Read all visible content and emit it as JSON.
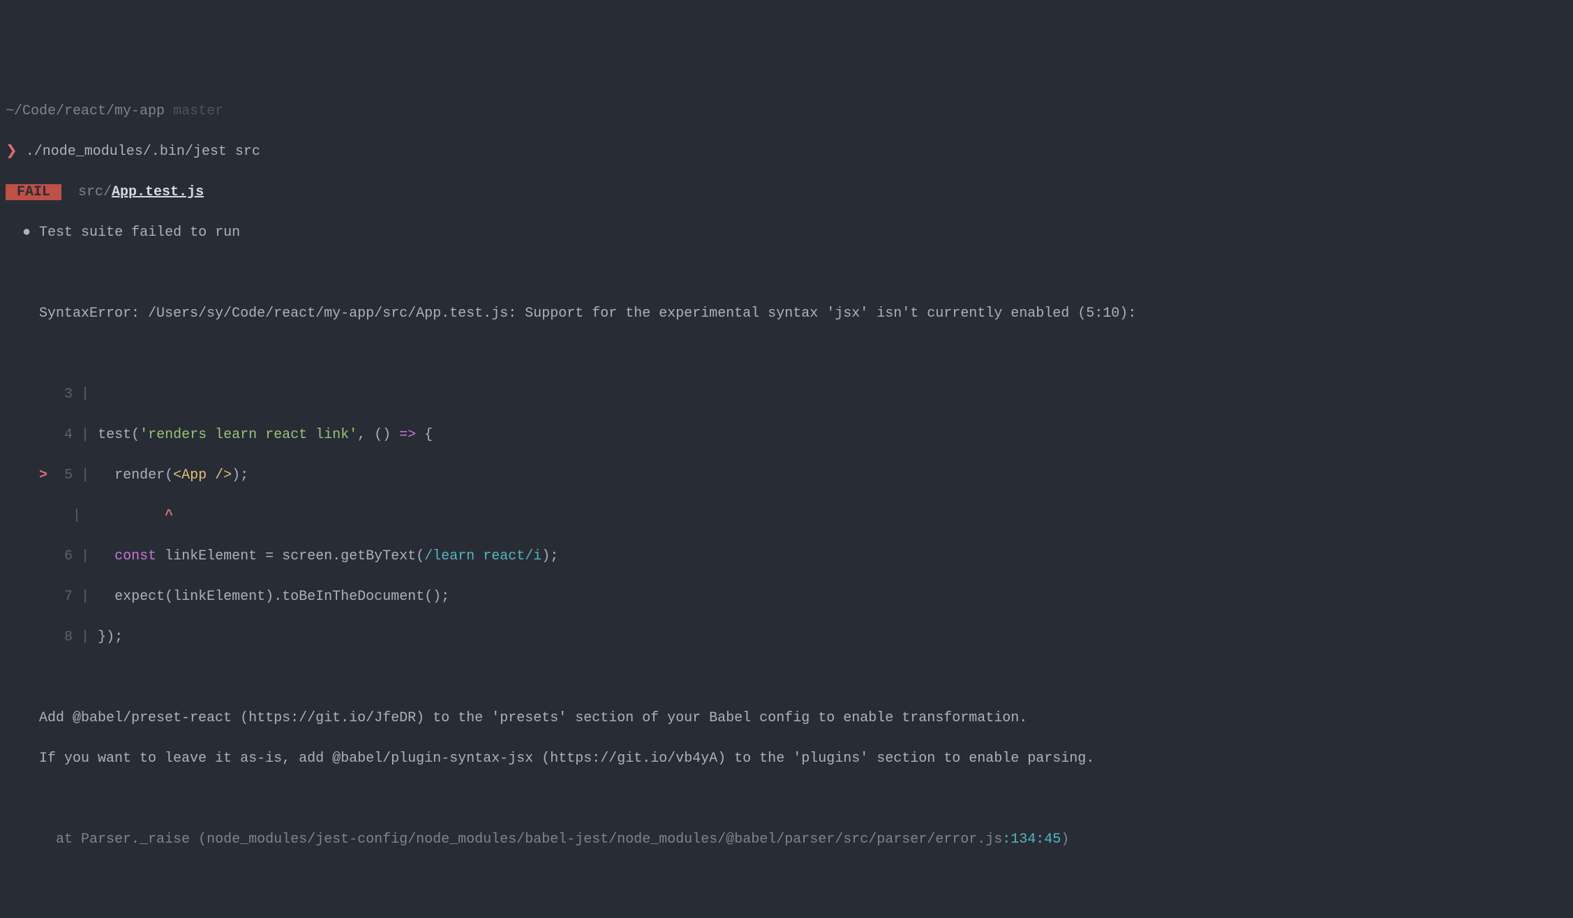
{
  "prompt": {
    "path": "~/Code/react/my-app",
    "branch": "master",
    "arrow": "❯",
    "command": "./node_modules/.bin/jest src"
  },
  "fail": {
    "badge": " FAIL ",
    "dir": "src/",
    "file": "App.test.js"
  },
  "suite_failed": "Test suite failed to run",
  "bullet": "●",
  "syntax_error": "SyntaxError: /Users/sy/Code/react/my-app/src/App.test.js: Support for the experimental syntax 'jsx' isn't currently enabled (5:10):",
  "code": {
    "l3_num": "3",
    "l4_num": "4",
    "l4_a": "test(",
    "l4_b": "'renders learn react link'",
    "l4_c": ", () ",
    "l4_arrow": "=>",
    "l4_d": " {",
    "l5_marker": ">",
    "l5_num": "5",
    "l5_a": "  render(",
    "l5_b": "<App />",
    "l5_c": ");",
    "caret": "         ^",
    "l6_num": "6",
    "l6_a": "  ",
    "l6_const": "const",
    "l6_b": " linkElement = screen.getByText(",
    "l6_regex": "/learn react/i",
    "l6_c": ");",
    "l7_num": "7",
    "l7_a": "  expect(linkElement).toBeInTheDocument();",
    "l8_num": "8",
    "l8_a": "});"
  },
  "hint1": "Add @babel/preset-react (https://git.io/JfeDR) to the 'presets' section of your Babel config to enable transformation.",
  "hint2": "If you want to leave it as-is, add @babel/plugin-syntax-jsx (https://git.io/vb4yA) to the 'plugins' section to enable parsing.",
  "stack": {
    "at": "  at Parser._raise (",
    "path": "node_modules/jest-config/node_modules/babel-jest/node_modules/@babel/parser/src/parser/error.js",
    "loc": ":134:45",
    "close": ")"
  }
}
